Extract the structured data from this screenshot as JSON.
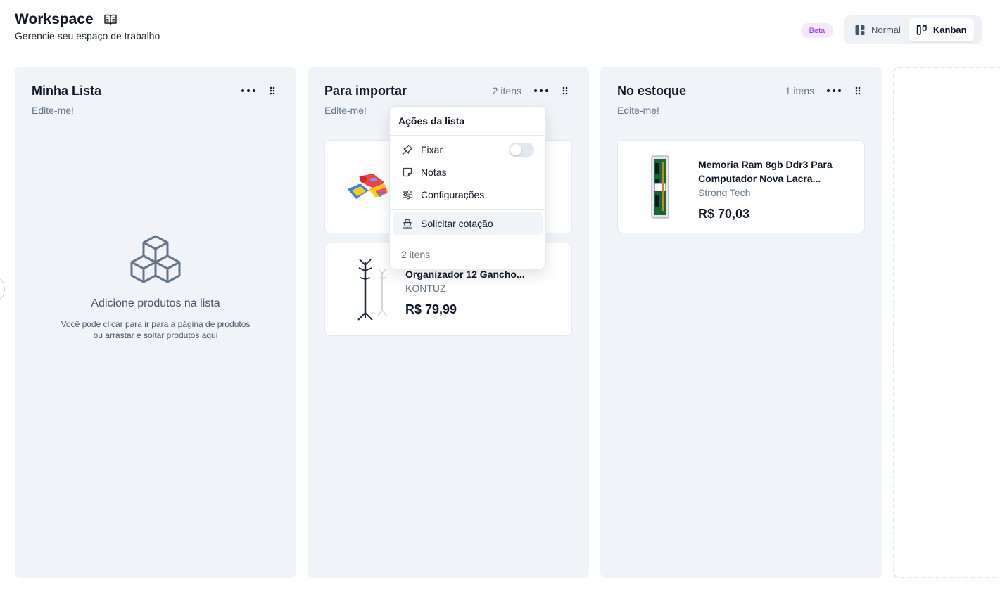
{
  "header": {
    "title": "Workspace",
    "subtitle": "Gerencie seu espaço de trabalho",
    "book_icon": "book-open-icon"
  },
  "badge": {
    "label": "Beta",
    "color": "#9333ea"
  },
  "view_toggle": {
    "normal_label": "Normal",
    "kanban_label": "Kanban",
    "selected": "Kanban"
  },
  "columns": [
    {
      "title": "Minha Lista",
      "count": "",
      "note": "Edite-me!",
      "empty": {
        "title": "Adicione produtos na lista",
        "desc_line1": "Você pode clicar para ir para a página de produtos",
        "desc_line2": "ou arrastar e soltar produtos aqui"
      }
    },
    {
      "title": "Para importar",
      "count": "2 itens",
      "note": "Edite-me!",
      "cards": [
        {
          "name": "",
          "brand": "",
          "price": "",
          "image": "toy-image"
        },
        {
          "name": "Organizador 12 Gancho...",
          "brand": "KONTUZ",
          "price": "R$ 79,99",
          "image": "coat-rack-image"
        }
      ]
    },
    {
      "title": "No estoque",
      "count": "1 itens",
      "note": "Edite-me!",
      "cards": [
        {
          "name_line1": "Memoria Ram 8gb Ddr3 Para",
          "name_line2": "Computador Nova Lacra...",
          "brand": "Strong Tech",
          "price": "R$ 70,03",
          "image": "ram-module-image"
        }
      ]
    }
  ],
  "dropdown": {
    "title": "Ações da lista",
    "items": [
      {
        "label": "Fixar",
        "icon": "pin-icon"
      },
      {
        "label": "Notas",
        "icon": "note-icon"
      },
      {
        "label": "Configurações",
        "icon": "sliders-icon"
      },
      {
        "label": "Solicitar cotação",
        "icon": "ship-icon"
      }
    ],
    "footer": "2 itens",
    "pin_enabled": false
  }
}
